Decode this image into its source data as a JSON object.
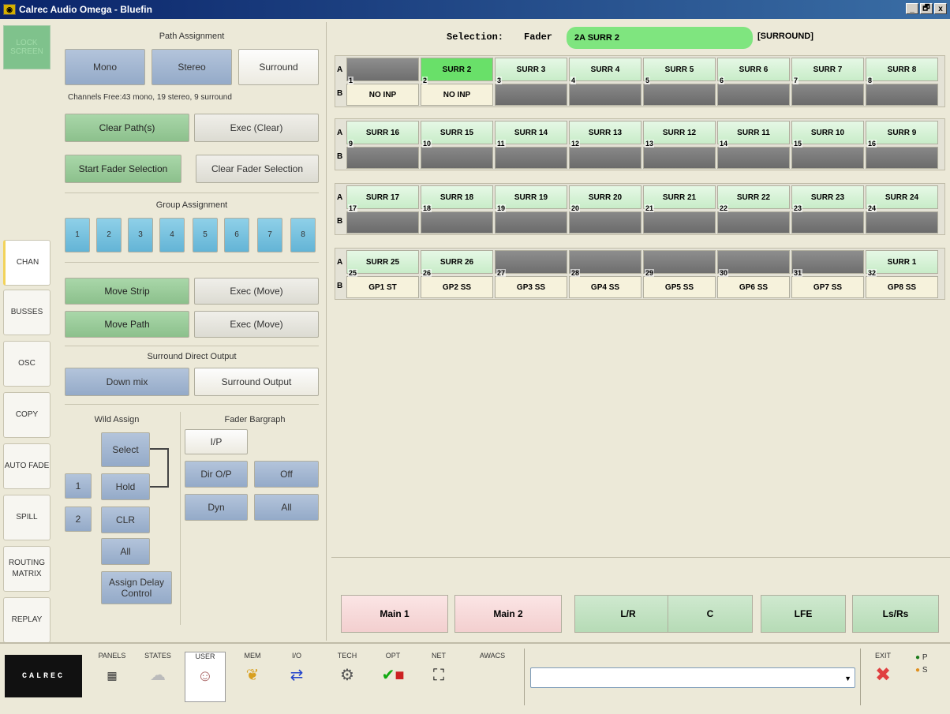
{
  "window": {
    "title": "Calrec Audio Omega - Bluefin",
    "controls": [
      "_",
      "🗗",
      "x"
    ]
  },
  "left_tabs": {
    "lock_screen": "LOCK SCREEN",
    "items": [
      "CHAN",
      "BUSSES",
      "OSC",
      "COPY",
      "AUTO FADE",
      "SPILL",
      "ROUTING MATRIX",
      "REPLAY"
    ]
  },
  "path_assignment": {
    "title": "Path Assignment",
    "mono": "Mono",
    "stereo": "Stereo",
    "surround": "Surround",
    "channels_free": "Channels Free:43 mono, 19 stereo, 9 surround",
    "clear_paths": "Clear Path(s)",
    "exec_clear": "Exec (Clear)",
    "start_fader_selection": "Start Fader Selection",
    "clear_fader_selection": "Clear Fader Selection"
  },
  "group_assignment": {
    "title": "Group Assignment",
    "groups": [
      "1",
      "2",
      "3",
      "4",
      "5",
      "6",
      "7",
      "8"
    ]
  },
  "move": {
    "move_strip": "Move Strip",
    "exec_move_1": "Exec (Move)",
    "move_path": "Move Path",
    "exec_move_2": "Exec (Move)"
  },
  "surround_direct_output": {
    "title": "Surround Direct Output",
    "down_mix": "Down mix",
    "surround_output": "Surround Output"
  },
  "wild_assign": {
    "title": "Wild Assign",
    "select": "Select",
    "hold": "Hold",
    "clr": "CLR",
    "all": "All",
    "one": "1",
    "two": "2",
    "assign_delay": "Assign Delay Control"
  },
  "fader_bargraph": {
    "title": "Fader Bargraph",
    "ip": "I/P",
    "dir_op": "Dir O/P",
    "off": "Off",
    "dyn": "Dyn",
    "all": "All"
  },
  "selection": {
    "label": "Selection:",
    "type": "Fader",
    "value": "2A SURR 2",
    "mode": "[SURROUND]"
  },
  "fader_rows": [
    {
      "a": [
        "",
        "SURR 2",
        "SURR 3",
        "SURR 4",
        "SURR 5",
        "SURR 6",
        "SURR 7",
        "SURR 8"
      ],
      "b": [
        "NO INP",
        "NO INP",
        "",
        "",
        "",
        "",
        "",
        ""
      ],
      "nums": [
        "1",
        "2",
        "3",
        "4",
        "5",
        "6",
        "7",
        "8"
      ]
    },
    {
      "a": [
        "SURR 16",
        "SURR 15",
        "SURR 14",
        "SURR 13",
        "SURR 12",
        "SURR 11",
        "SURR 10",
        "SURR 9"
      ],
      "b": [
        "",
        "",
        "",
        "",
        "",
        "",
        "",
        ""
      ],
      "nums": [
        "9",
        "10",
        "11",
        "12",
        "13",
        "14",
        "15",
        "16"
      ]
    },
    {
      "a": [
        "SURR 17",
        "SURR 18",
        "SURR 19",
        "SURR 20",
        "SURR 21",
        "SURR 22",
        "SURR 23",
        "SURR 24"
      ],
      "b": [
        "",
        "",
        "",
        "",
        "",
        "",
        "",
        ""
      ],
      "nums": [
        "17",
        "18",
        "19",
        "20",
        "21",
        "22",
        "23",
        "24"
      ]
    },
    {
      "a": [
        "SURR 25",
        "SURR 26",
        "",
        "",
        "",
        "",
        "",
        "SURR 1"
      ],
      "b": [
        "GP1 ST",
        "GP2 SS",
        "GP3 SS",
        "GP4 SS",
        "GP5 SS",
        "GP6 SS",
        "GP7 SS",
        "GP8 SS"
      ],
      "nums": [
        "25",
        "26",
        "27",
        "28",
        "29",
        "30",
        "31",
        "32"
      ]
    }
  ],
  "row_labels": {
    "a": "A",
    "b": "B"
  },
  "outputs": [
    "Main 1",
    "Main 2",
    "L/R",
    "C",
    "LFE",
    "Ls/Rs"
  ],
  "bottom": {
    "logo": "CALREC",
    "items": [
      "PANELS",
      "STATES",
      "USER",
      "MEM",
      "I/O",
      "TECH",
      "OPT",
      "NET",
      "AWACS"
    ],
    "exit": "EXIT",
    "p": "P",
    "s": "S"
  },
  "colors": {
    "title_bar": "#0a246a",
    "selected_fader": "#69e069",
    "selection_field": "#7fe57f"
  }
}
